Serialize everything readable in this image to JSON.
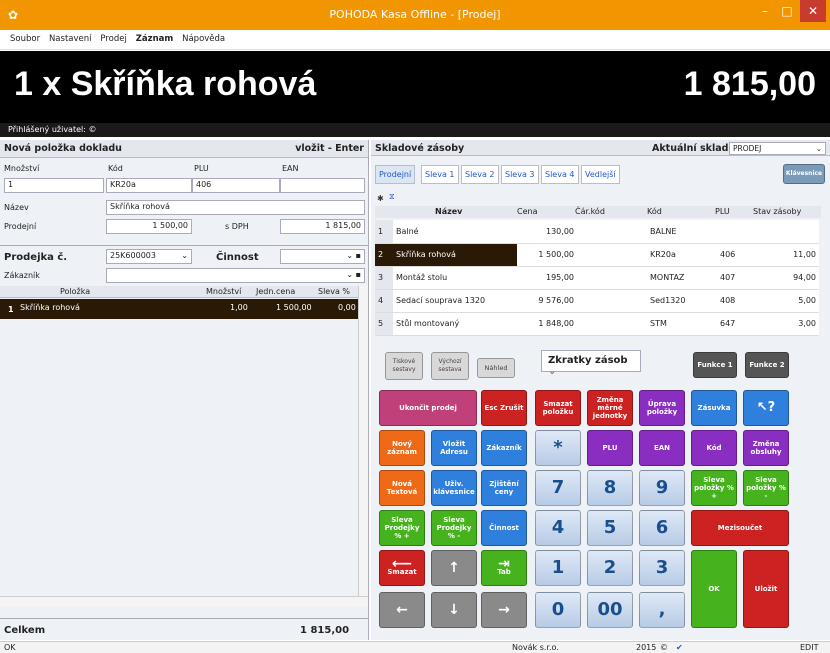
{
  "window": {
    "title": "POHODA Kasa Offline - [Prodej]"
  },
  "menu": [
    "Soubor",
    "Nastavení",
    "Prodej",
    "Záznam",
    "Nápověda"
  ],
  "banner": {
    "item": "1 x  Skříňka rohová",
    "price": "1 815,00"
  },
  "user_label": "Přihlášený uživatel: ©",
  "new_item": {
    "header": "Nová položka dokladu",
    "hint": "vložit - Enter",
    "qty_label": "Množství",
    "qty": "1",
    "code_label": "Kód",
    "code": "KR20a",
    "plu_label": "PLU",
    "plu": "406",
    "ean_label": "EAN",
    "ean": "",
    "name_label": "Název",
    "name": "Skříňka rohová",
    "sale_label": "Prodejní",
    "sale_price": "1 500,00",
    "vat_label": "s DPH",
    "vat_price": "1 815,00"
  },
  "sale": {
    "label": "Prodejka č.",
    "number": "25K600003",
    "activity_label": "Činnost",
    "customer_label": "Zákazník",
    "cols": [
      "Položka",
      "Množství",
      "Jedn.cena",
      "Sleva %"
    ],
    "rows": [
      {
        "n": "1",
        "item": "Skříňka rohová",
        "qty": "1,00",
        "price": "1 500,00",
        "disc": "0,00"
      }
    ]
  },
  "total": {
    "label": "Celkem",
    "value": "1 815,00"
  },
  "stock": {
    "header": "Skladové zásoby",
    "current_label": "Aktuální sklad",
    "current": "PRODEJ",
    "tabs": [
      "Prodejní",
      "Sleva 1",
      "Sleva 2",
      "Sleva 3",
      "Sleva 4",
      "Vedlejší"
    ],
    "keyboard_btn": "Klávesnice",
    "cols": [
      "Název",
      "Cena",
      "Čár.kód",
      "Kód",
      "PLU",
      "Stav zásoby"
    ],
    "rows": [
      {
        "n": "1",
        "name": "Balné",
        "price": "130,00",
        "bar": "",
        "code": "BALNE",
        "plu": "",
        "stock": ""
      },
      {
        "n": "2",
        "name": "Skříňka rohová",
        "price": "1 500,00",
        "bar": "",
        "code": "KR20a",
        "plu": "406",
        "stock": "11,00"
      },
      {
        "n": "3",
        "name": "Montáž stolu",
        "price": "195,00",
        "bar": "",
        "code": "MONTAZ",
        "plu": "407",
        "stock": "94,00"
      },
      {
        "n": "4",
        "name": "Sedací souprava 1320",
        "price": "9 576,00",
        "bar": "",
        "code": "Sed1320",
        "plu": "408",
        "stock": "5,00"
      },
      {
        "n": "5",
        "name": "Stůl montovaný",
        "price": "1 848,00",
        "bar": "",
        "code": "STM",
        "plu": "647",
        "stock": "3,00"
      }
    ]
  },
  "tools": {
    "print": "Tiskové sestavy",
    "default": "Výchozí sestava",
    "preview": "Náhled",
    "shortcuts": "Zkratky zásob",
    "f1": "Funkce 1",
    "f2": "Funkce 2"
  },
  "keys": {
    "end": "Ukončit prodej",
    "esc": "Esc Zrušit",
    "del_item": "Smazat položku",
    "change_unit": "Změna měrné jednotky",
    "edit_item": "Úprava položky",
    "drawer": "Zásuvka",
    "help": "↖?",
    "new_rec": "Nový záznam",
    "add_addr": "Vložit Adresu",
    "customer": "Zákazník",
    "star": "*",
    "plu": "PLU",
    "ean": "EAN",
    "code": "Kód",
    "change_op": "Změna obsluhy",
    "new_text": "Nová Textová",
    "user_kb": "Uživ. klávesnice",
    "price_check": "Zjištění ceny",
    "disc_plus": "Sleva položky % +",
    "disc_minus": "Sleva položky % -",
    "sale_plus": "Sleva Prodejky % +",
    "sale_minus": "Sleva Prodejky % -",
    "activity": "Činnost",
    "subtotal": "Mezisoučet",
    "delete": "Smazat",
    "tab": "Tab",
    "ok": "OK",
    "save": "Uložit",
    "n7": "7",
    "n8": "8",
    "n9": "9",
    "n4": "4",
    "n5": "5",
    "n6": "6",
    "n1": "1",
    "n2": "2",
    "n3": "3",
    "n0": "0",
    "n00": "00",
    "comma": ","
  },
  "status": {
    "left": "OK",
    "company": "Novák s.r.o.",
    "year": "2015",
    "mode": "EDIT"
  },
  "colors": {
    "title": "#f19600",
    "banner": "#000000",
    "selected_row": "#2a1a05"
  }
}
